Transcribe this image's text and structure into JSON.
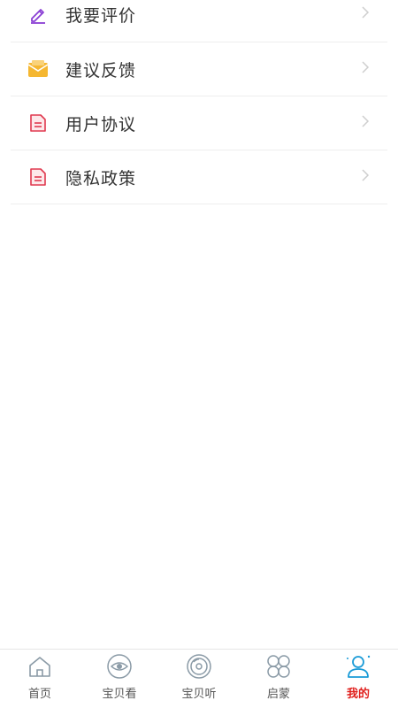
{
  "menu": {
    "items": [
      {
        "label": "我要评价",
        "icon": "pencil-icon",
        "color": "#8a3fd4"
      },
      {
        "label": "建议反馈",
        "icon": "envelope-icon",
        "color": "#f5b731"
      },
      {
        "label": "用户协议",
        "icon": "document-icon",
        "color": "#e0394f"
      },
      {
        "label": "隐私政策",
        "icon": "document-icon",
        "color": "#e0394f"
      }
    ]
  },
  "tabbar": {
    "tabs": [
      {
        "label": "首页",
        "icon": "home-icon",
        "active": false
      },
      {
        "label": "宝贝看",
        "icon": "eye-icon",
        "active": false
      },
      {
        "label": "宝贝听",
        "icon": "disc-icon",
        "active": false
      },
      {
        "label": "启蒙",
        "icon": "grid-icon",
        "active": false
      },
      {
        "label": "我的",
        "icon": "user-icon",
        "active": true
      }
    ],
    "active_color": "#e0201d",
    "icon_color": "#8a9aa6",
    "active_icon_color": "#1a9bd7"
  }
}
